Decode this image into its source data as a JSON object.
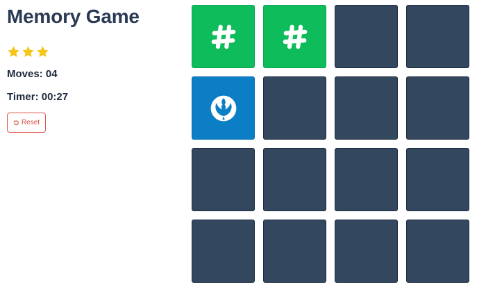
{
  "game": {
    "title": "Memory Game",
    "rating_stars": 3,
    "moves_label": "Moves: 04",
    "timer_label": "Timer: 00:27",
    "reset_label": "Reset"
  },
  "colors": {
    "title": "#2a3a54",
    "star": "#f5c518",
    "card_back": "#33475f",
    "card_matched": "#0fbc5c",
    "card_open": "#0c7ec6",
    "reset": "#d94b43"
  },
  "board": {
    "rows": 4,
    "columns": 4,
    "cards": [
      {
        "state": "matched",
        "icon": "hashtag-icon"
      },
      {
        "state": "matched",
        "icon": "hashtag-icon"
      },
      {
        "state": "hidden",
        "icon": ""
      },
      {
        "state": "hidden",
        "icon": ""
      },
      {
        "state": "open",
        "icon": "rebel-alliance-icon"
      },
      {
        "state": "hidden",
        "icon": ""
      },
      {
        "state": "hidden",
        "icon": ""
      },
      {
        "state": "hidden",
        "icon": ""
      },
      {
        "state": "hidden",
        "icon": ""
      },
      {
        "state": "hidden",
        "icon": ""
      },
      {
        "state": "hidden",
        "icon": ""
      },
      {
        "state": "hidden",
        "icon": ""
      },
      {
        "state": "hidden",
        "icon": ""
      },
      {
        "state": "hidden",
        "icon": ""
      },
      {
        "state": "hidden",
        "icon": ""
      },
      {
        "state": "hidden",
        "icon": ""
      }
    ]
  }
}
